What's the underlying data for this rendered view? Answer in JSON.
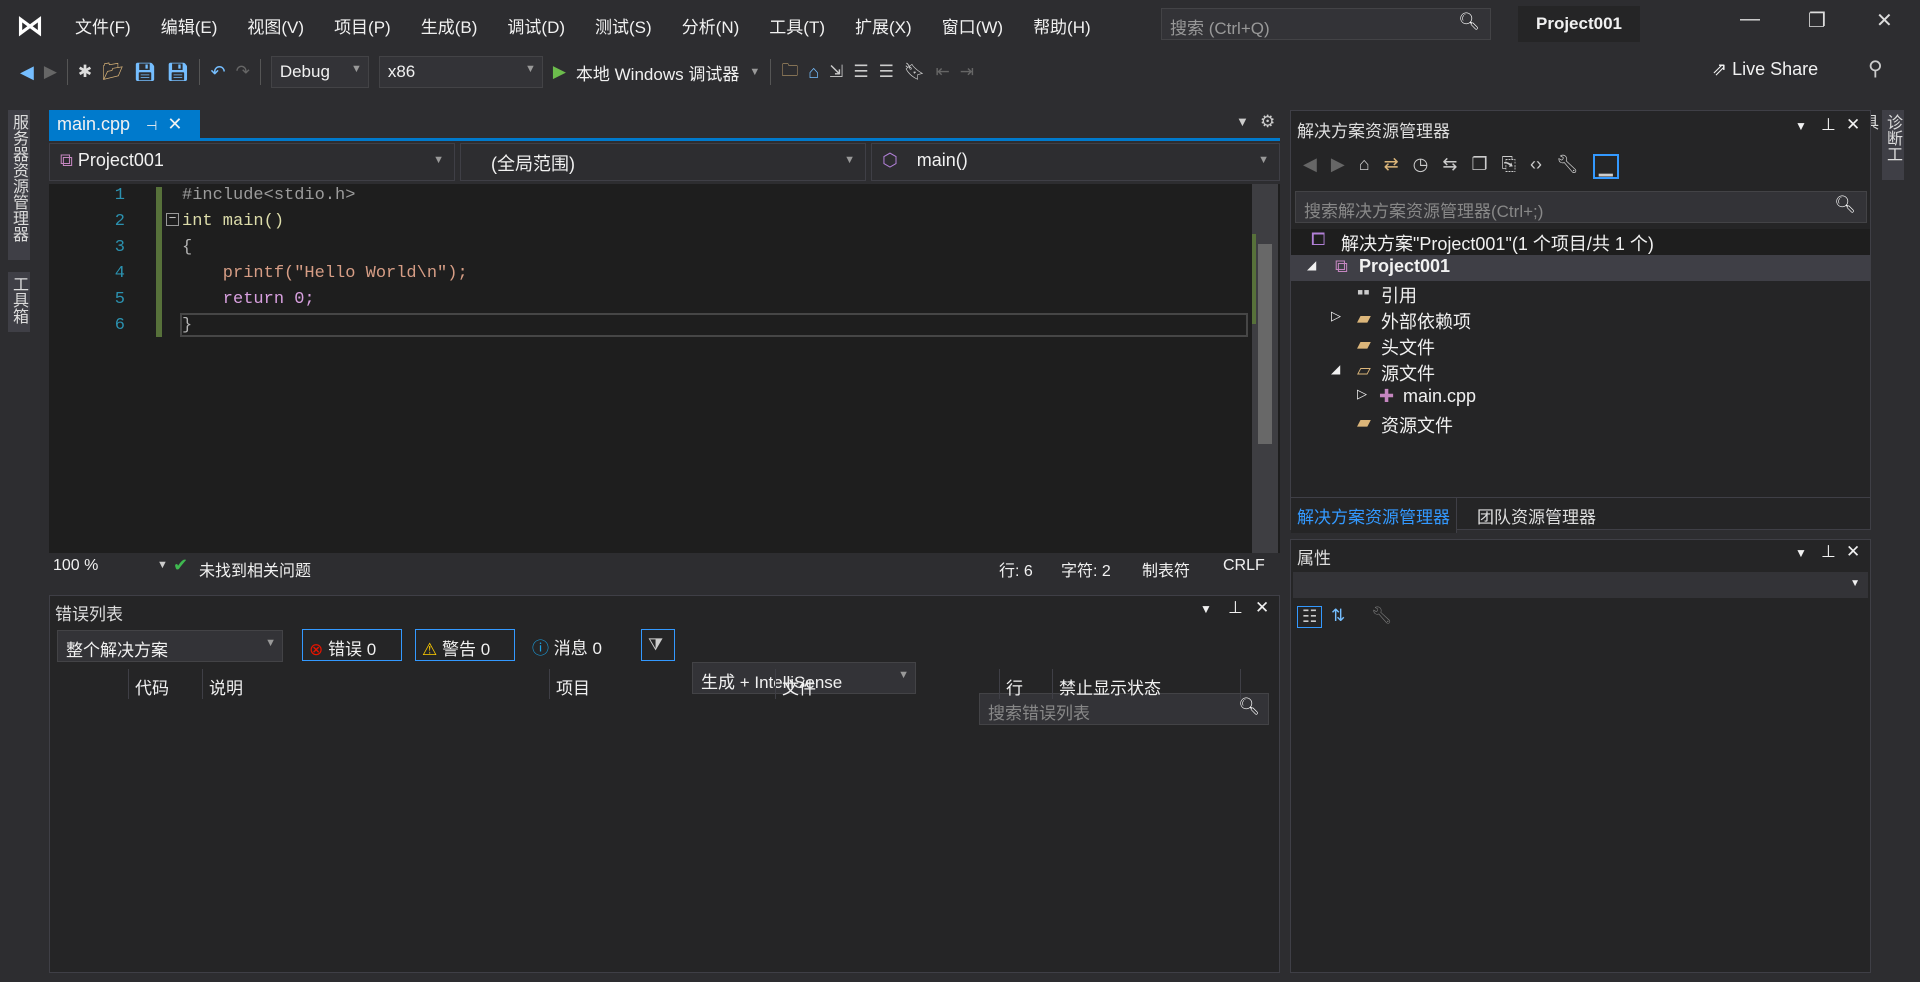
{
  "menu": {
    "items": [
      "文件(F)",
      "编辑(E)",
      "视图(V)",
      "项目(P)",
      "生成(B)",
      "调试(D)",
      "测试(S)",
      "分析(N)",
      "工具(T)",
      "扩展(X)",
      "窗口(W)",
      "帮助(H)"
    ],
    "search_placeholder": "搜索 (Ctrl+Q)",
    "project_title": "Project001"
  },
  "toolbar": {
    "config": "Debug",
    "platform": "x86",
    "run": "本地 Windows 调试器",
    "live_share": "Live Share"
  },
  "side_tabs": {
    "left": [
      "服务器资源管理器",
      "工具箱"
    ],
    "right": "诊断工具"
  },
  "editor": {
    "tab": "main.cpp",
    "nav_project": "Project001",
    "nav_scope": "(全局范围)",
    "nav_member": "main()",
    "lines": [
      {
        "n": "1",
        "t": "#include<stdio.h>"
      },
      {
        "n": "2",
        "t": "int main()"
      },
      {
        "n": "3",
        "t": "{"
      },
      {
        "n": "4",
        "t": "    printf(\"Hello World\\n\");"
      },
      {
        "n": "5",
        "t": "    return 0;"
      },
      {
        "n": "6",
        "t": "}"
      }
    ],
    "zoom": "100 %",
    "issues": "未找到相关问题",
    "row": "行: 6",
    "col": "字符: 2",
    "tabs": "制表符",
    "eol": "CRLF"
  },
  "error_list": {
    "title": "错误列表",
    "scope": "整个解决方案",
    "errors": "错误 0",
    "warnings": "警告 0",
    "messages": "消息 0",
    "source": "生成 + IntelliSense",
    "search_placeholder": "搜索错误列表",
    "columns": [
      "代码",
      "说明",
      "项目",
      "文件",
      "行",
      "禁止显示状态"
    ]
  },
  "solution_explorer": {
    "title": "解决方案资源管理器",
    "search_placeholder": "搜索解决方案资源管理器(Ctrl+;)",
    "solution": "解决方案\"Project001\"(1 个项目/共 1 个)",
    "project": "Project001",
    "items": [
      "引用",
      "外部依赖项",
      "头文件",
      "源文件",
      "main.cpp",
      "资源文件"
    ],
    "tab_active": "解决方案资源管理器",
    "tab_other": "团队资源管理器"
  },
  "properties": {
    "title": "属性"
  },
  "colors": {
    "accent": "#007acc",
    "background": "#2d2d30",
    "editor": "#1e1e1e"
  }
}
